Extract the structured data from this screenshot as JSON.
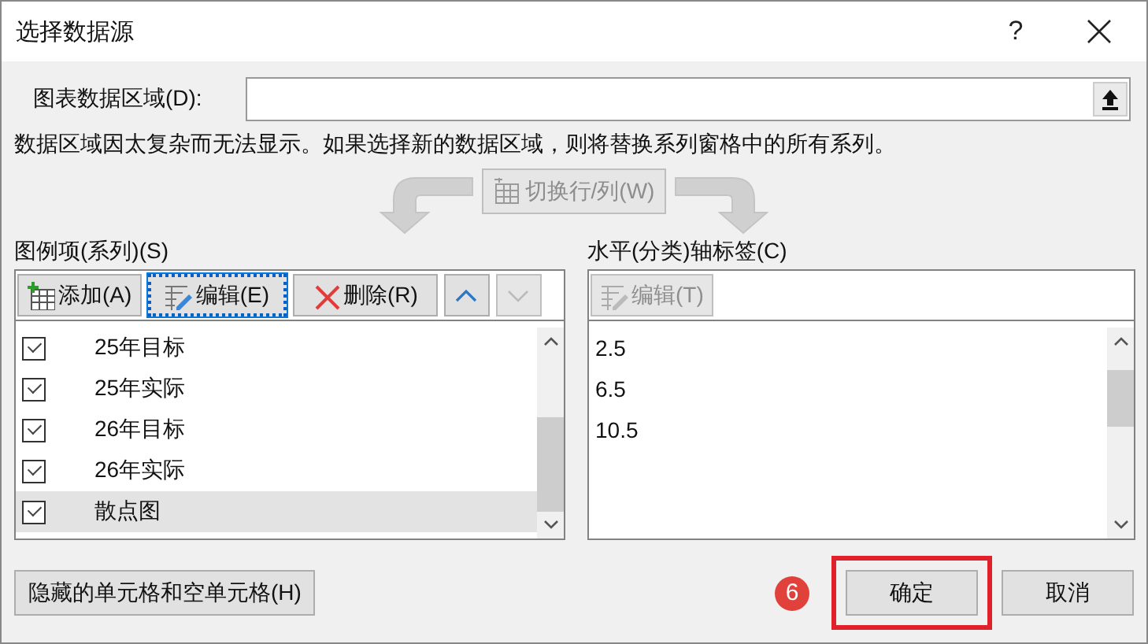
{
  "window": {
    "title": "选择数据源",
    "help": "?"
  },
  "data_range": {
    "label": "图表数据区域(D):"
  },
  "message": "数据区域因太复杂而无法显示。如果选择新的数据区域，则将替换系列窗格中的所有系列。",
  "switch_button": {
    "label": "切换行/列(W)",
    "disabled": true
  },
  "legend_entries": {
    "label": "图例项(系列)(S)",
    "toolbar": [
      {
        "kind": "add",
        "label": "添加(A)",
        "disabled": false,
        "focused": false
      },
      {
        "kind": "edit",
        "label": "编辑(E)",
        "disabled": false,
        "focused": true
      },
      {
        "kind": "remove",
        "label": "删除(R)",
        "disabled": false,
        "focused": false
      },
      {
        "kind": "up",
        "disabled": false,
        "focused": false
      },
      {
        "kind": "down",
        "disabled": true,
        "focused": false
      }
    ],
    "items": [
      {
        "label": "25年目标",
        "checked": true,
        "selected": false
      },
      {
        "label": "25年实际",
        "checked": true,
        "selected": false
      },
      {
        "label": "26年目标",
        "checked": true,
        "selected": false
      },
      {
        "label": "26年实际",
        "checked": true,
        "selected": false
      },
      {
        "label": "散点图",
        "checked": true,
        "selected": true
      }
    ]
  },
  "axis_labels": {
    "label": "水平(分类)轴标签(C)",
    "edit_button": {
      "label": "编辑(T)",
      "disabled": true
    },
    "items": [
      "2.5",
      "6.5",
      "10.5"
    ]
  },
  "buttons": [
    {
      "kind": "hidden_cells",
      "label": "隐藏的单元格和空单元格(H)",
      "highlighted": false
    },
    {
      "kind": "ok",
      "label": "确定",
      "highlighted": true,
      "step": "6"
    },
    {
      "kind": "cancel",
      "label": "取消",
      "highlighted": false
    }
  ]
}
